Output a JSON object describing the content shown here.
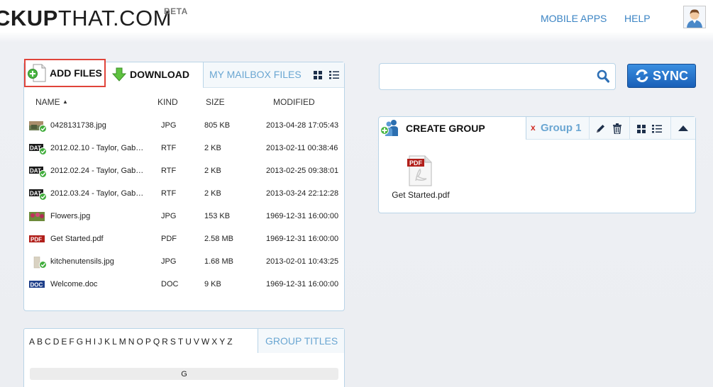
{
  "header": {
    "logo_bold": "CKUP",
    "logo_light": "THAT.COM",
    "beta": "BETA",
    "nav": [
      "MOBILE APPS",
      "HELP"
    ]
  },
  "files_panel": {
    "add_files": "ADD FILES",
    "download": "DOWNLOAD",
    "mailbox_tab": "MY MAILBOX FILES",
    "columns": {
      "name": "NAME",
      "kind": "KIND",
      "size": "SIZE",
      "modified": "MODIFIED"
    },
    "rows": [
      {
        "name": "0428131738.jpg",
        "kind": "JPG",
        "size": "805 KB",
        "modified": "2013-04-28 17:05:43",
        "icon": "image-file-icon"
      },
      {
        "name": "2012.02.10 - Taylor, Gab…",
        "kind": "RTF",
        "size": "2 KB",
        "modified": "2013-02-11 00:38:46",
        "icon": "dat-file-icon"
      },
      {
        "name": "2012.02.24 - Taylor, Gab…",
        "kind": "RTF",
        "size": "2 KB",
        "modified": "2013-02-25 09:38:01",
        "icon": "dat-file-icon"
      },
      {
        "name": "2012.03.24 - Taylor, Gab…",
        "kind": "RTF",
        "size": "2 KB",
        "modified": "2013-03-24 22:12:28",
        "icon": "dat-file-icon"
      },
      {
        "name": "Flowers.jpg",
        "kind": "JPG",
        "size": "153 KB",
        "modified": "1969-12-31 16:00:00",
        "icon": "image-file-icon"
      },
      {
        "name": "Get Started.pdf",
        "kind": "PDF",
        "size": "2.58 MB",
        "modified": "1969-12-31 16:00:00",
        "icon": "pdf-file-icon"
      },
      {
        "name": "kitchenutensils.jpg",
        "kind": "JPG",
        "size": "1.68 MB",
        "modified": "2013-02-01 10:43:25",
        "icon": "image-file-icon"
      },
      {
        "name": "Welcome.doc",
        "kind": "DOC",
        "size": "9 KB",
        "modified": "1969-12-31 16:00:00",
        "icon": "doc-file-icon"
      }
    ],
    "file_badges": {
      "dat": "DAT",
      "pdf": "PDF",
      "doc": "DOC"
    }
  },
  "alpha_panel": {
    "letters": [
      "A",
      "B",
      "C",
      "D",
      "E",
      "F",
      "G",
      "H",
      "I",
      "J",
      "K",
      "L",
      "M",
      "N",
      "O",
      "P",
      "Q",
      "R",
      "S",
      "T",
      "U",
      "V",
      "W",
      "X",
      "Y",
      "Z"
    ],
    "group_titles_tab": "GROUP TITLES",
    "section_header": "G"
  },
  "search": {
    "placeholder": ""
  },
  "sync_label": "SYNC",
  "group_panel": {
    "create_group": "CREATE GROUP",
    "close_x": "x",
    "group_name": "Group 1",
    "file_label": "Get Started.pdf",
    "pdf_badge": "PDF"
  },
  "colors": {
    "accent_blue": "#3b84c4",
    "tab_text": "#6aa6d2",
    "sync_blue": "#1a60b8",
    "highlight_red": "#e0443a"
  }
}
